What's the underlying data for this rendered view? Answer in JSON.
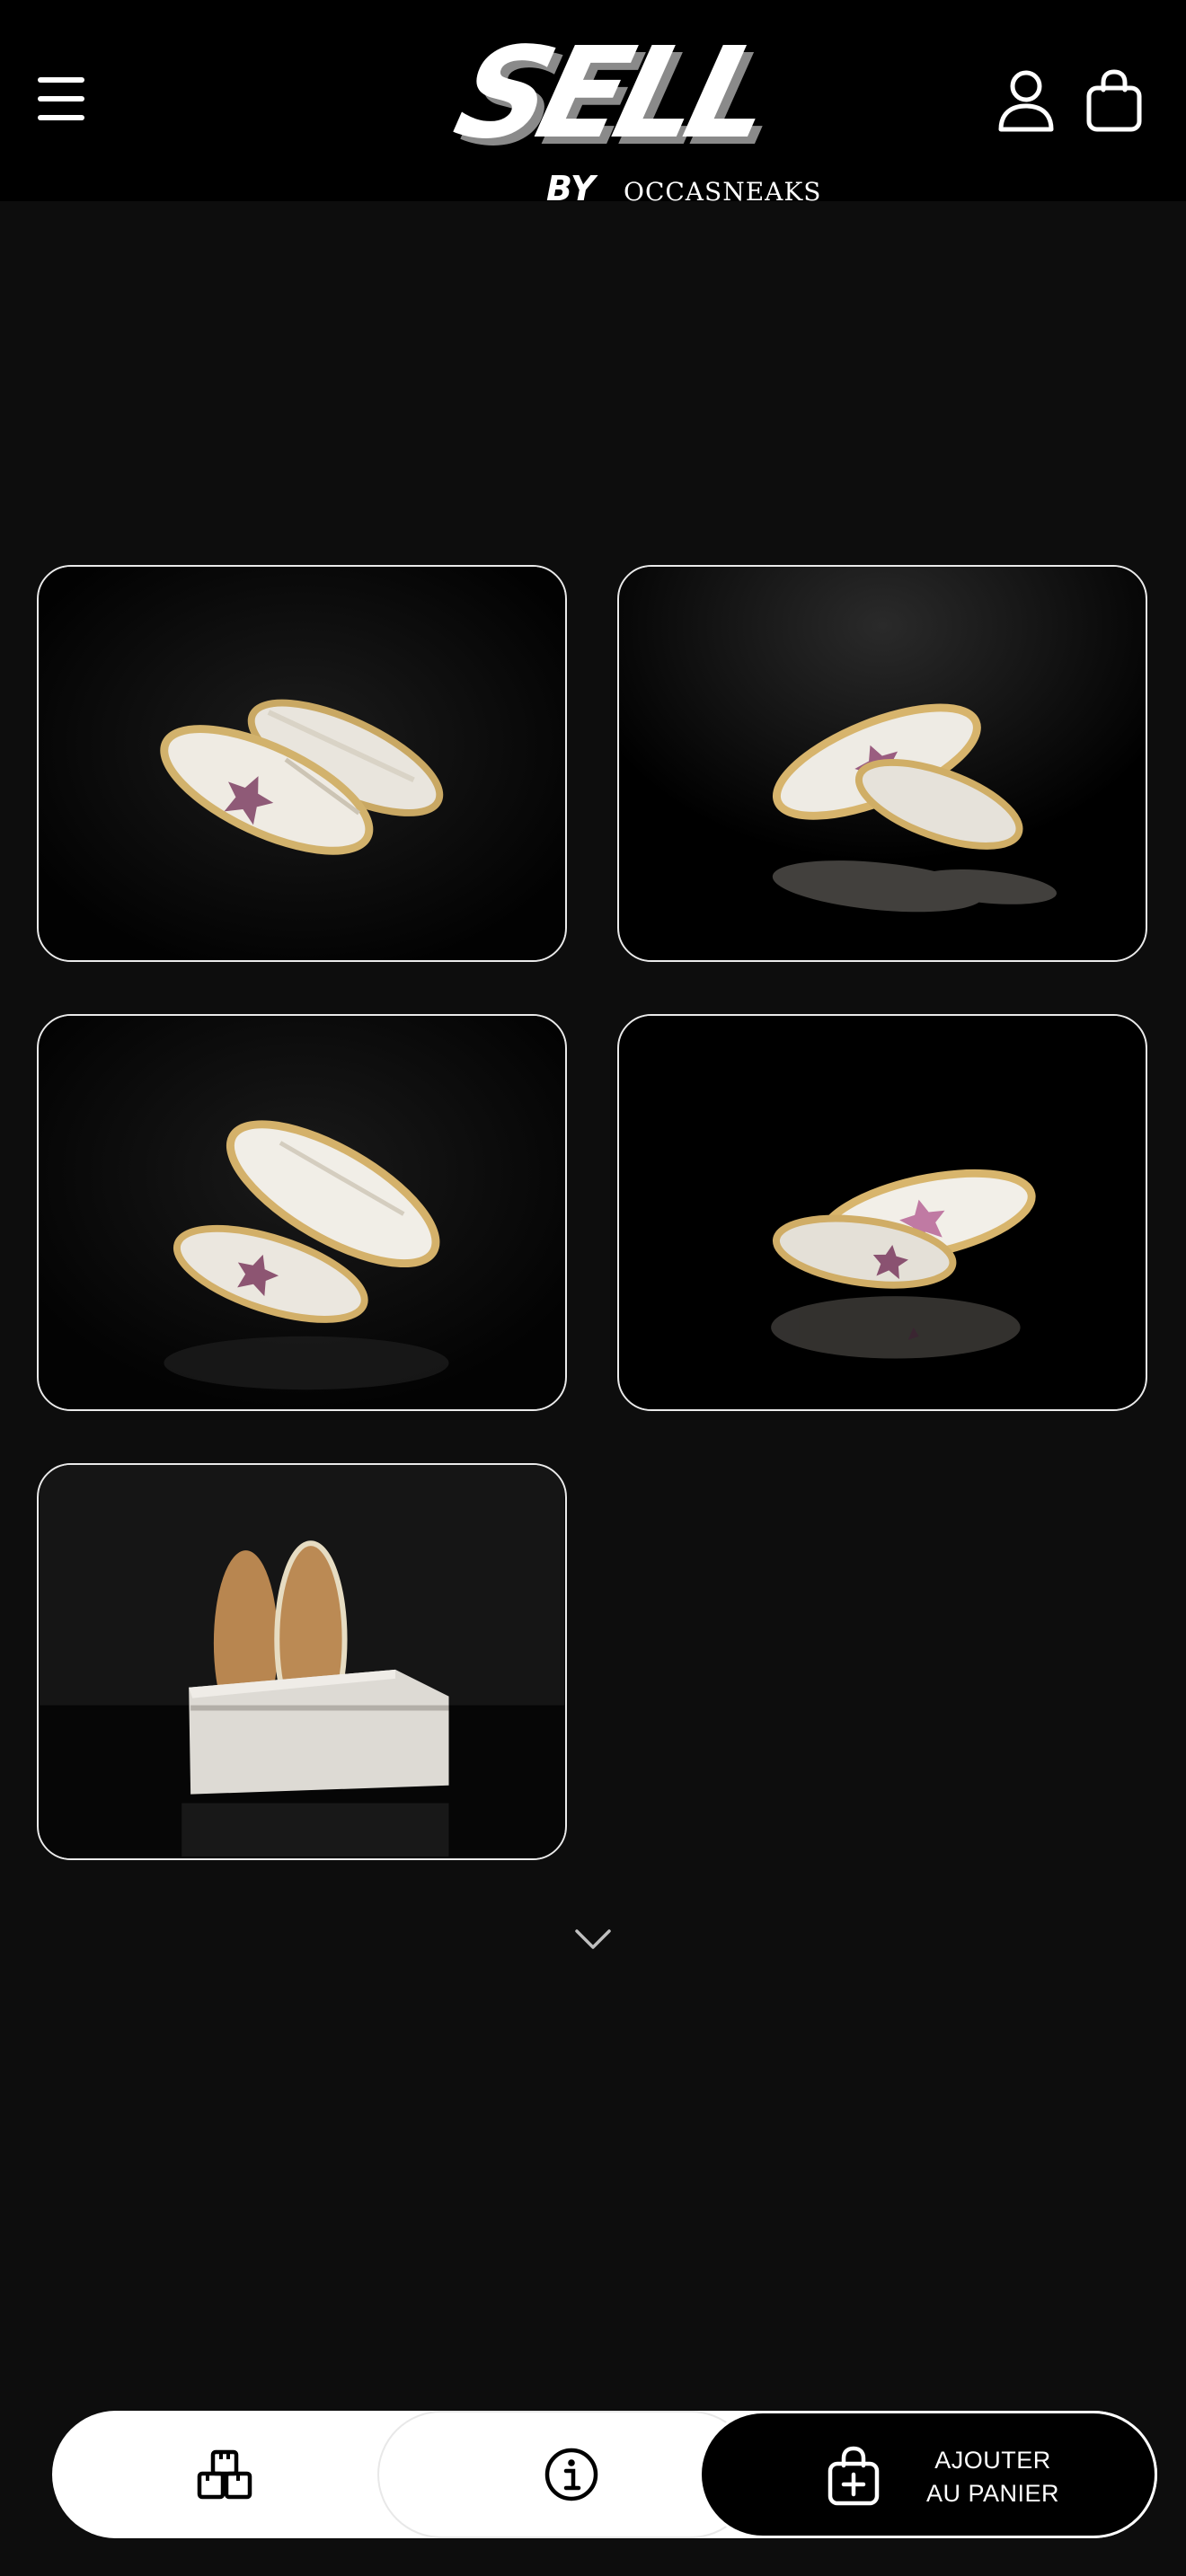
{
  "header": {
    "logo": {
      "main": "SELL",
      "by": "BY",
      "brand": "OCCASNEAKS"
    },
    "menu_icon": "hamburger-menu-icon",
    "account_icon": "user-icon",
    "cart_icon": "shopping-bag-icon"
  },
  "gallery": {
    "photos": [
      {
        "alt": "Paire de sneakers blanches à étoile rose, vue de trois-quarts"
      },
      {
        "alt": "Sneakers blanches à étoile rose, reflet sur fond noir"
      },
      {
        "alt": "Sneakers blanches à étoile rose, vue latérale"
      },
      {
        "alt": "Sneakers blanches à étoile rose, vue de côté avec reflet"
      },
      {
        "alt": "Semelles de sneakers dans une boîte blanche"
      }
    ],
    "scroll_icon": "chevron-down-icon"
  },
  "bottom_bar": {
    "compare_icon": "boxes-compare-icon",
    "info_icon": "info-icon",
    "add_to_cart": {
      "line1": "AJOUTER",
      "line2": "AU PANIER",
      "icon": "bag-plus-icon"
    }
  },
  "colors": {
    "background": "#0d0d0d",
    "header": "#000000",
    "accent": "#ffffff"
  }
}
